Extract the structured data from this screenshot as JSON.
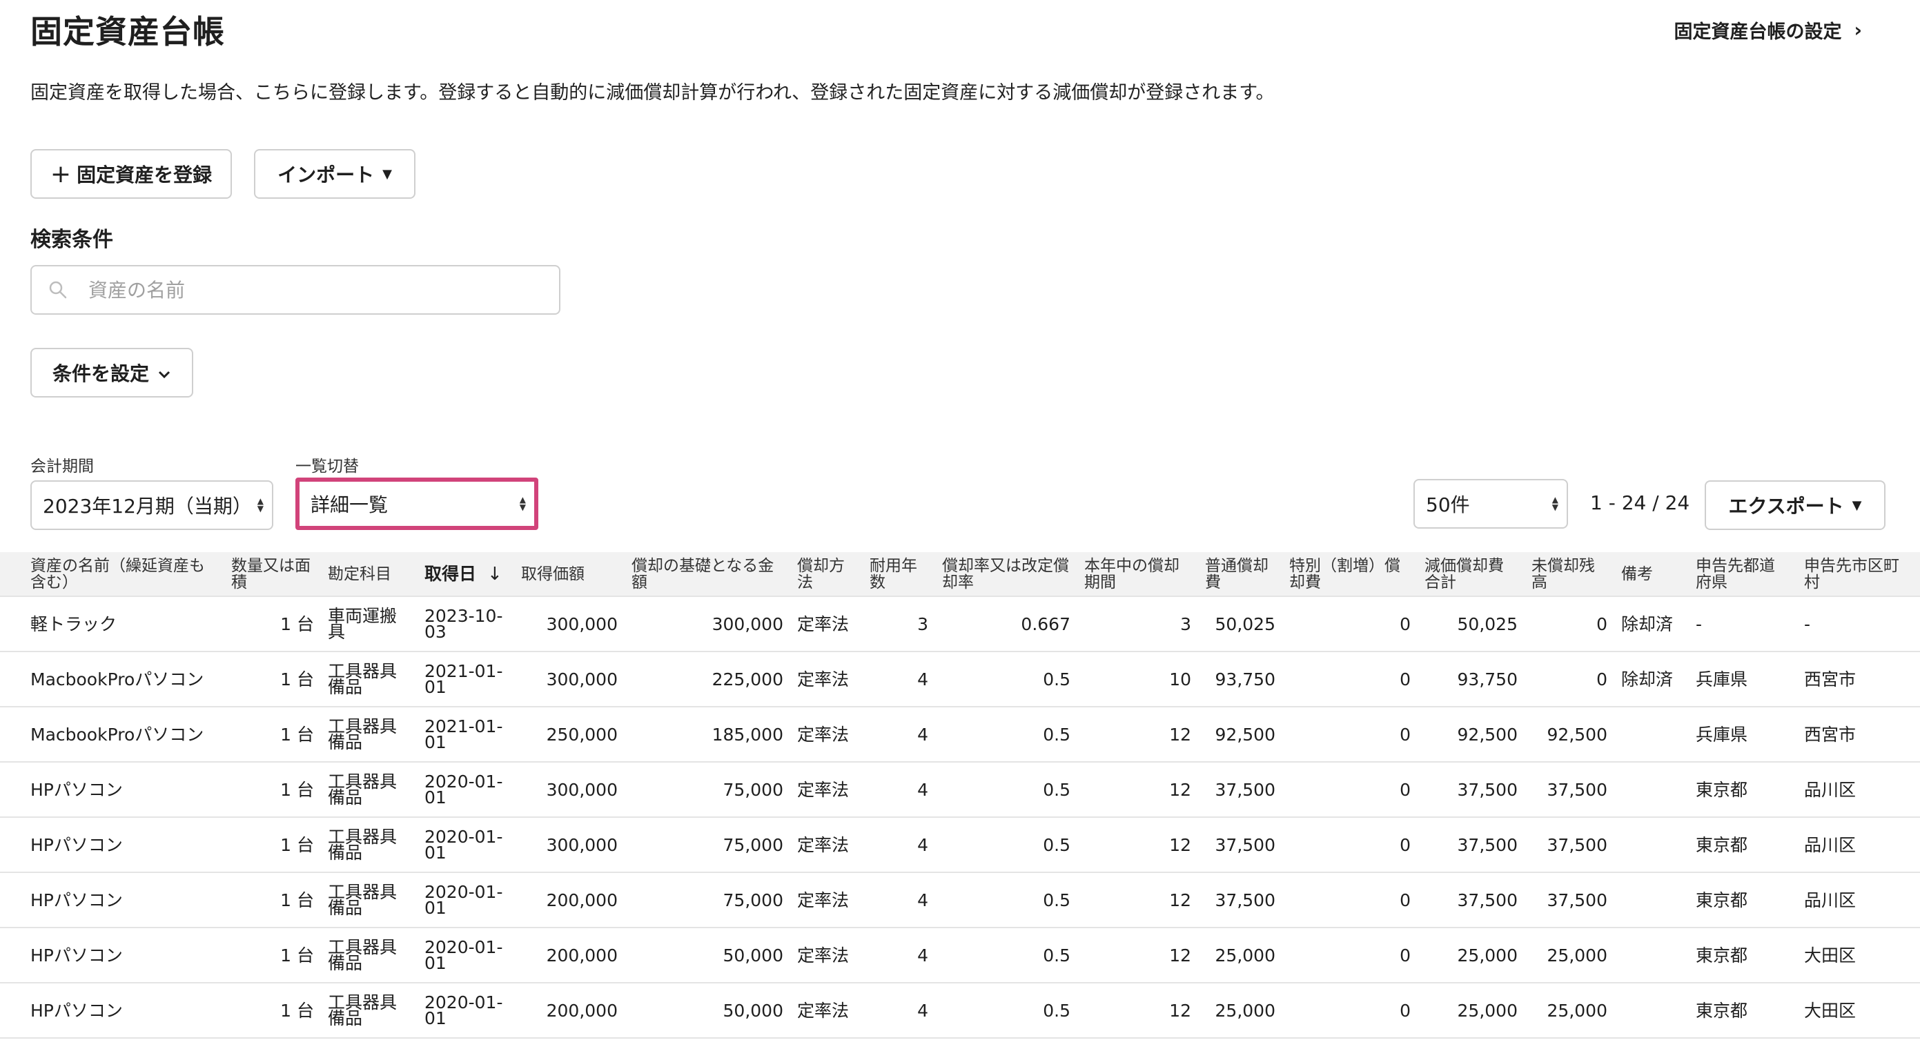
{
  "header": {
    "title": "固定資産台帳",
    "settings_link": "固定資産台帳の設定",
    "description": "固定資産を取得した場合、こちらに登録します。登録すると自動的に減価償却計算が行われ、登録された固定資産に対する減価償却が登録されます。"
  },
  "actions": {
    "register_label": "固定資産を登録",
    "import_label": "インポート"
  },
  "search": {
    "heading": "検索条件",
    "placeholder": "資産の名前",
    "conditions_label": "条件を設定"
  },
  "filters": {
    "period_label": "会計期間",
    "period_value": "2023年12月期（当期）",
    "view_label": "一覧切替",
    "view_value": "詳細一覧",
    "per_page_value": "50件",
    "pagination_text": "1 - 24 / 24",
    "export_label": "エクスポート"
  },
  "colors": {
    "highlight": "#d1437a",
    "header_bg": "#f2f2f2",
    "border": "#cfcfcf"
  },
  "table": {
    "columns": [
      "資産の名前（繰延資産も含む）",
      "数量又は面積",
      "勘定科目",
      "取得日",
      "取得価額",
      "償却の基礎となる金額",
      "償却方法",
      "耐用年数",
      "償却率又は改定償却率",
      "本年中の償却期間",
      "普通償却費",
      "特別（割増）償却費",
      "減価償却費合計",
      "未償却残高",
      "備考",
      "申告先都道府県",
      "申告先市区町村"
    ],
    "sort_icon": "arrow-down-icon",
    "rows": [
      [
        "軽トラック",
        "1 台",
        "車両運搬具",
        "2023-10-03",
        "300,000",
        "300,000",
        "定率法",
        "3",
        "0.667",
        "3",
        "50,025",
        "0",
        "50,025",
        "0",
        "除却済",
        "-",
        "-"
      ],
      [
        "MacbookProパソコン",
        "1 台",
        "工具器具備品",
        "2021-01-01",
        "300,000",
        "225,000",
        "定率法",
        "4",
        "0.5",
        "10",
        "93,750",
        "0",
        "93,750",
        "0",
        "除却済",
        "兵庫県",
        "西宮市"
      ],
      [
        "MacbookProパソコン",
        "1 台",
        "工具器具備品",
        "2021-01-01",
        "250,000",
        "185,000",
        "定率法",
        "4",
        "0.5",
        "12",
        "92,500",
        "0",
        "92,500",
        "92,500",
        "",
        "兵庫県",
        "西宮市"
      ],
      [
        "HPパソコン",
        "1 台",
        "工具器具備品",
        "2020-01-01",
        "300,000",
        "75,000",
        "定率法",
        "4",
        "0.5",
        "12",
        "37,500",
        "0",
        "37,500",
        "37,500",
        "",
        "東京都",
        "品川区"
      ],
      [
        "HPパソコン",
        "1 台",
        "工具器具備品",
        "2020-01-01",
        "300,000",
        "75,000",
        "定率法",
        "4",
        "0.5",
        "12",
        "37,500",
        "0",
        "37,500",
        "37,500",
        "",
        "東京都",
        "品川区"
      ],
      [
        "HPパソコン",
        "1 台",
        "工具器具備品",
        "2020-01-01",
        "200,000",
        "75,000",
        "定率法",
        "4",
        "0.5",
        "12",
        "37,500",
        "0",
        "37,500",
        "37,500",
        "",
        "東京都",
        "品川区"
      ],
      [
        "HPパソコン",
        "1 台",
        "工具器具備品",
        "2020-01-01",
        "200,000",
        "50,000",
        "定率法",
        "4",
        "0.5",
        "12",
        "25,000",
        "0",
        "25,000",
        "25,000",
        "",
        "東京都",
        "大田区"
      ],
      [
        "HPパソコン",
        "1 台",
        "工具器具備品",
        "2020-01-01",
        "200,000",
        "50,000",
        "定率法",
        "4",
        "0.5",
        "12",
        "25,000",
        "0",
        "25,000",
        "25,000",
        "",
        "東京都",
        "大田区"
      ]
    ]
  }
}
